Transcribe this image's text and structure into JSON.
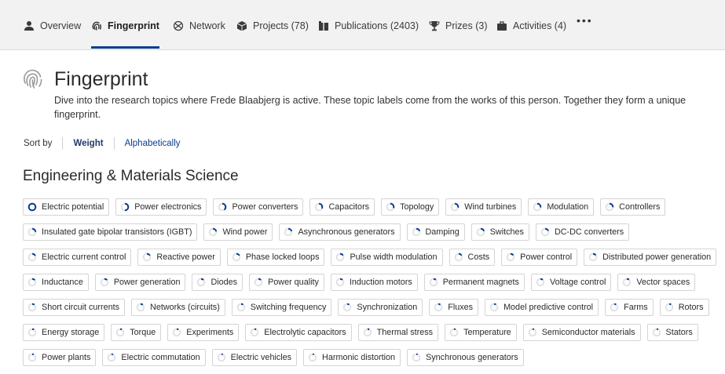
{
  "tabs": [
    {
      "label": "Overview",
      "icon": "person-icon"
    },
    {
      "label": "Fingerprint",
      "icon": "fingerprint-icon",
      "active": true
    },
    {
      "label": "Network",
      "icon": "network-icon"
    },
    {
      "label": "Projects (78)",
      "icon": "projects-cube-icon"
    },
    {
      "label": "Publications (2403)",
      "icon": "book-icon"
    },
    {
      "label": "Prizes (3)",
      "icon": "trophy-icon"
    },
    {
      "label": "Activities (4)",
      "icon": "briefcase-icon"
    }
  ],
  "more_label": "•••",
  "heading": {
    "title": "Fingerprint",
    "description": "Dive into the research topics where Frede Blaabjerg is active. These topic labels come from the works of this person. Together they form a unique fingerprint."
  },
  "sort": {
    "label": "Sort by",
    "options": [
      "Weight",
      "Alphabetically"
    ],
    "active": "Weight"
  },
  "section_title": "Engineering & Materials Science",
  "accent_color": "#0b3d91",
  "chip_rows": [
    [
      {
        "label": "Electric potential",
        "weight": 1.0
      },
      {
        "label": "Power electronics",
        "weight": 0.5
      },
      {
        "label": "Power converters",
        "weight": 0.4
      },
      {
        "label": "Capacitors",
        "weight": 0.32
      },
      {
        "label": "Topology",
        "weight": 0.3
      },
      {
        "label": "Wind turbines",
        "weight": 0.28
      },
      {
        "label": "Modulation",
        "weight": 0.27
      },
      {
        "label": "Controllers",
        "weight": 0.26
      }
    ],
    [
      {
        "label": "Insulated gate bipolar transistors (IGBT)",
        "weight": 0.24
      },
      {
        "label": "Wind power",
        "weight": 0.22
      },
      {
        "label": "Asynchronous generators",
        "weight": 0.21
      },
      {
        "label": "Damping",
        "weight": 0.2
      },
      {
        "label": "Switches",
        "weight": 0.2
      },
      {
        "label": "DC-DC converters",
        "weight": 0.19
      }
    ],
    [
      {
        "label": "Electric current control",
        "weight": 0.18
      },
      {
        "label": "Reactive power",
        "weight": 0.17
      },
      {
        "label": "Phase locked loops",
        "weight": 0.17
      },
      {
        "label": "Pulse width modulation",
        "weight": 0.16
      },
      {
        "label": "Costs",
        "weight": 0.16
      },
      {
        "label": "Power control",
        "weight": 0.15
      },
      {
        "label": "Distributed power generation",
        "weight": 0.15
      }
    ],
    [
      {
        "label": "Inductance",
        "weight": 0.14
      },
      {
        "label": "Power generation",
        "weight": 0.14
      },
      {
        "label": "Diodes",
        "weight": 0.13
      },
      {
        "label": "Power quality",
        "weight": 0.13
      },
      {
        "label": "Induction motors",
        "weight": 0.12
      },
      {
        "label": "Permanent magnets",
        "weight": 0.12
      },
      {
        "label": "Voltage control",
        "weight": 0.12
      },
      {
        "label": "Vector spaces",
        "weight": 0.11
      }
    ],
    [
      {
        "label": "Short circuit currents",
        "weight": 0.11
      },
      {
        "label": "Networks (circuits)",
        "weight": 0.11
      },
      {
        "label": "Switching frequency",
        "weight": 0.1
      },
      {
        "label": "Synchronization",
        "weight": 0.1
      },
      {
        "label": "Fluxes",
        "weight": 0.1
      },
      {
        "label": "Model predictive control",
        "weight": 0.09
      },
      {
        "label": "Farms",
        "weight": 0.09
      },
      {
        "label": "Rotors",
        "weight": 0.09
      }
    ],
    [
      {
        "label": "Energy storage",
        "weight": 0.09
      },
      {
        "label": "Torque",
        "weight": 0.08
      },
      {
        "label": "Experiments",
        "weight": 0.08
      },
      {
        "label": "Electrolytic capacitors",
        "weight": 0.08
      },
      {
        "label": "Thermal stress",
        "weight": 0.08
      },
      {
        "label": "Temperature",
        "weight": 0.07
      },
      {
        "label": "Semiconductor materials",
        "weight": 0.07
      },
      {
        "label": "Stators",
        "weight": 0.07
      }
    ],
    [
      {
        "label": "Power plants",
        "weight": 0.07
      },
      {
        "label": "Electric commutation",
        "weight": 0.07
      },
      {
        "label": "Electric vehicles",
        "weight": 0.06
      },
      {
        "label": "Harmonic distortion",
        "weight": 0.06
      },
      {
        "label": "Synchronous generators",
        "weight": 0.06
      }
    ]
  ]
}
